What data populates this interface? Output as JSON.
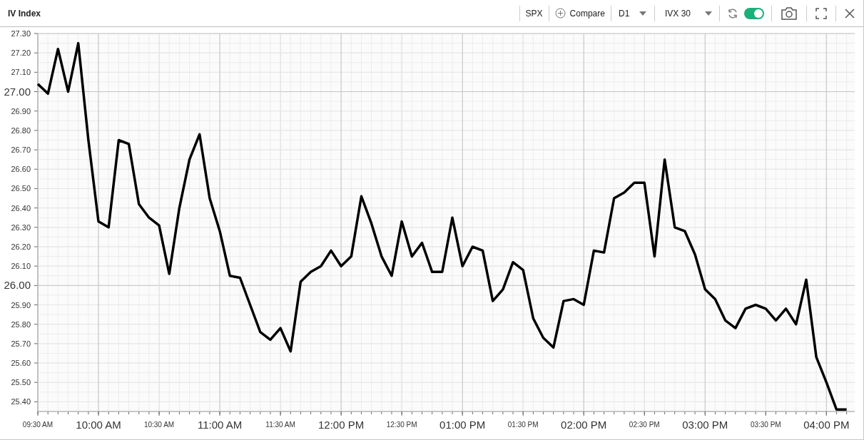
{
  "header": {
    "title": "IV Index"
  },
  "toolbar": {
    "symbol": "SPX",
    "compare": "Compare",
    "period": "D1",
    "metric": "IVX 30",
    "auto_refresh": {
      "on": true
    }
  },
  "chart": {
    "chart_data": {
      "type": "line",
      "grid": true,
      "ylim": [
        25.35,
        27.3
      ],
      "categories": [
        "09:30 AM",
        null,
        null,
        null,
        null,
        null,
        "10:00 AM",
        null,
        null,
        null,
        null,
        null,
        "10:30 AM",
        null,
        null,
        null,
        null,
        null,
        "11:00 AM",
        null,
        null,
        null,
        null,
        null,
        "11:30 AM",
        null,
        null,
        null,
        null,
        null,
        "12:00 PM",
        null,
        null,
        null,
        null,
        null,
        "12:30 PM",
        null,
        null,
        null,
        null,
        null,
        "01:00 PM",
        null,
        null,
        null,
        null,
        null,
        "01:30 PM",
        null,
        null,
        null,
        null,
        null,
        "02:00 PM",
        null,
        null,
        null,
        null,
        null,
        "02:30 PM",
        null,
        null,
        null,
        null,
        null,
        "03:00 PM",
        null,
        null,
        null,
        null,
        null,
        "03:30 PM",
        null,
        null,
        null,
        null,
        null,
        "04:00 PM",
        null,
        null
      ],
      "yticks": [
        {
          "value": 25.4,
          "label": "25.40"
        },
        {
          "value": 25.5,
          "label": "25.50"
        },
        {
          "value": 25.6,
          "label": "25.60"
        },
        {
          "value": 25.7,
          "label": "25.70"
        },
        {
          "value": 25.8,
          "label": "25.80"
        },
        {
          "value": 25.9,
          "label": "25.90"
        },
        {
          "value": 26,
          "label": "26.00"
        },
        {
          "value": 26.1,
          "label": "26.10"
        },
        {
          "value": 26.2,
          "label": "26.20"
        },
        {
          "value": 26.3,
          "label": "26.30"
        },
        {
          "value": 26.4,
          "label": "26.40"
        },
        {
          "value": 26.5,
          "label": "26.50"
        },
        {
          "value": 26.6,
          "label": "26.60"
        },
        {
          "value": 26.7,
          "label": "26.70"
        },
        {
          "value": 26.8,
          "label": "26.80"
        },
        {
          "value": 26.9,
          "label": "26.90"
        },
        {
          "value": 27,
          "label": "27.00"
        },
        {
          "value": 27.1,
          "label": "27.10"
        },
        {
          "value": 27.2,
          "label": "27.20"
        },
        {
          "value": 27.3,
          "label": "27.30"
        }
      ],
      "series": [
        {
          "color": "#000000",
          "values": [
            27.04,
            26.99,
            27.22,
            27.0,
            27.25,
            26.75,
            26.33,
            26.3,
            26.75,
            26.73,
            26.42,
            26.35,
            26.31,
            26.06,
            26.4,
            26.65,
            26.78,
            26.45,
            26.28,
            26.05,
            26.04,
            25.9,
            25.76,
            25.72,
            25.78,
            25.66,
            26.02,
            26.07,
            26.1,
            26.18,
            26.1,
            26.15,
            26.46,
            26.32,
            26.15,
            26.05,
            26.33,
            26.15,
            26.22,
            26.07,
            26.07,
            26.35,
            26.1,
            26.2,
            26.18,
            25.92,
            25.98,
            26.12,
            26.08,
            25.83,
            25.73,
            25.68,
            25.92,
            25.93,
            25.9,
            26.18,
            26.17,
            26.45,
            26.48,
            26.53,
            26.53,
            26.15,
            26.65,
            26.3,
            26.28,
            26.16,
            25.98,
            25.93,
            25.82,
            25.78,
            25.88,
            25.9,
            25.88,
            25.82,
            25.88,
            25.8,
            26.03,
            25.63,
            25.5,
            25.36,
            25.36
          ]
        }
      ]
    }
  }
}
